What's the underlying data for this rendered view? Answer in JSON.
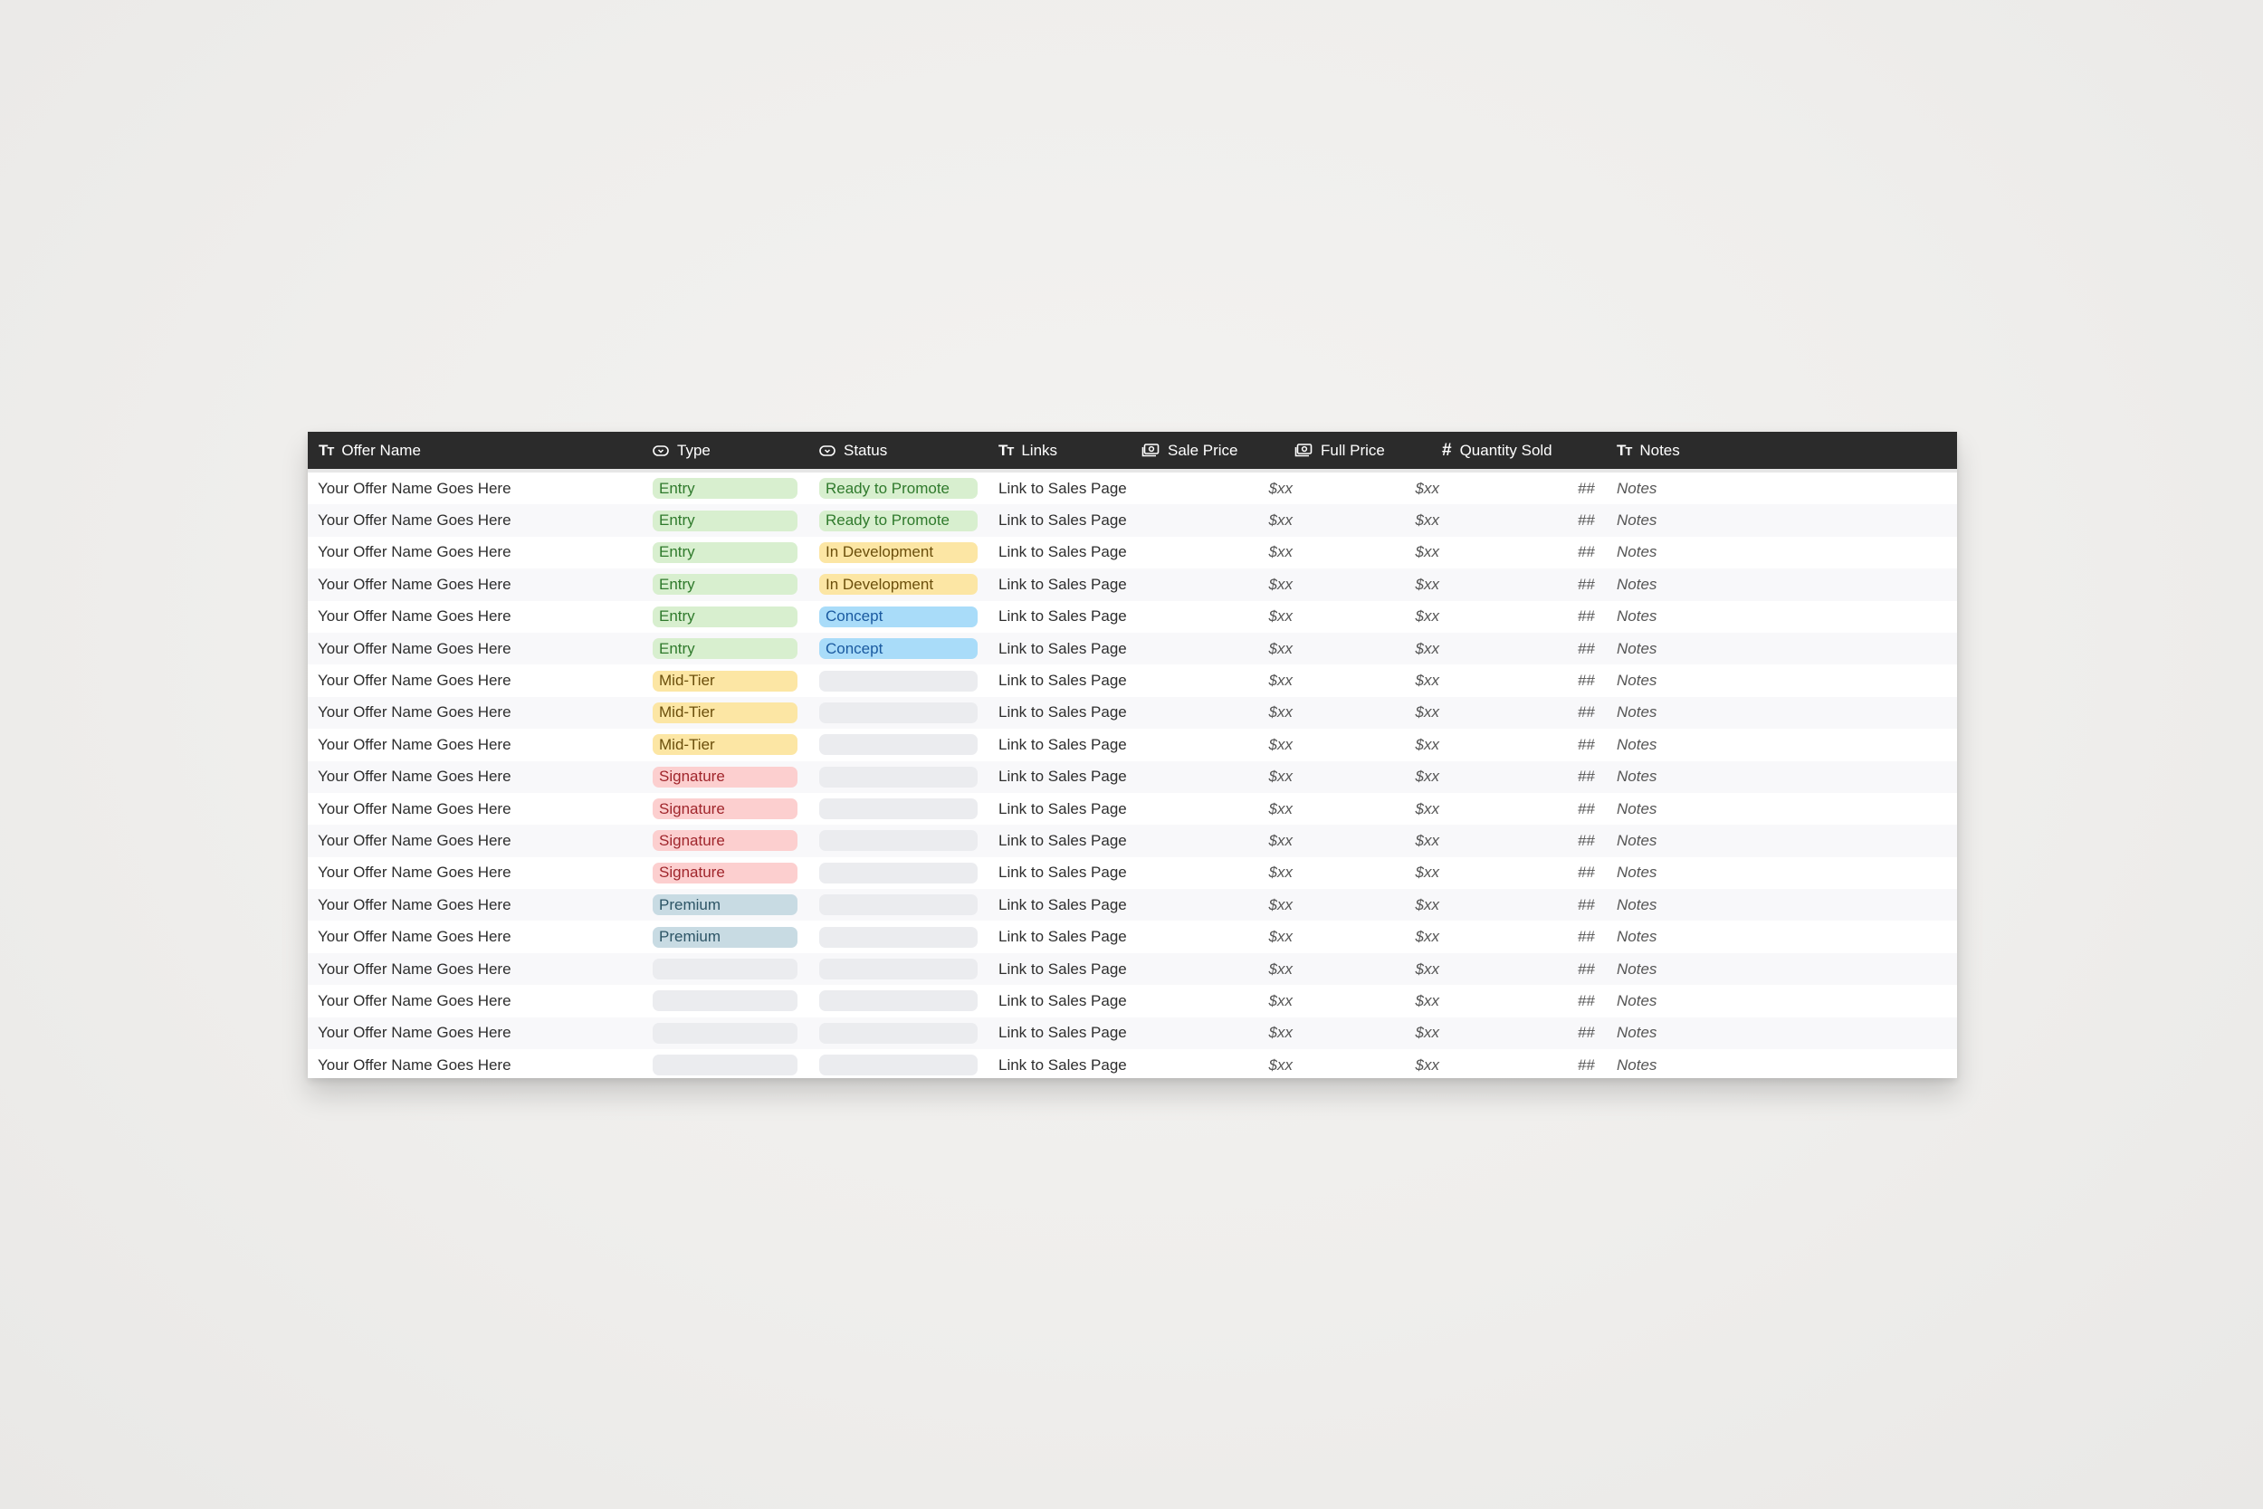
{
  "table": {
    "columns": [
      {
        "key": "name",
        "label": "Offer Name",
        "icon": "text-type-icon"
      },
      {
        "key": "type",
        "label": "Type",
        "icon": "select-icon"
      },
      {
        "key": "status",
        "label": "Status",
        "icon": "select-icon"
      },
      {
        "key": "links",
        "label": "Links",
        "icon": "text-type-icon"
      },
      {
        "key": "sale",
        "label": "Sale Price",
        "icon": "currency-icon"
      },
      {
        "key": "full",
        "label": "Full Price",
        "icon": "currency-icon"
      },
      {
        "key": "qty",
        "label": "Quantity Sold",
        "icon": "number-hash-icon"
      },
      {
        "key": "notes",
        "label": "Notes",
        "icon": "text-type-icon"
      }
    ],
    "colors": {
      "header_bg": "#2b2b2b",
      "row_alt_bg": "#f8f8fa",
      "empty_pill": "#ebecef"
    },
    "tags": {
      "Entry": {
        "bg": "#d8efcf",
        "fg": "#2f7a2c"
      },
      "Mid-Tier": {
        "bg": "#fce6a4",
        "fg": "#6b4f0c"
      },
      "Signature": {
        "bg": "#fccfcf",
        "fg": "#a0262c"
      },
      "Premium": {
        "bg": "#c8dbe3",
        "fg": "#2d5566"
      },
      "Ready to Promote": {
        "bg": "#d8efcf",
        "fg": "#2f7a2c"
      },
      "In Development": {
        "bg": "#fce6a4",
        "fg": "#6b4f0c"
      },
      "Concept": {
        "bg": "#a9dcf9",
        "fg": "#1a5aa0"
      }
    },
    "rows": [
      {
        "name": "Your Offer Name Goes Here",
        "type": "Entry",
        "status": "Ready to Promote",
        "links": "Link to Sales Page",
        "sale": "$xx",
        "full": "$xx",
        "qty": "##",
        "notes": "Notes"
      },
      {
        "name": "Your Offer Name Goes Here",
        "type": "Entry",
        "status": "Ready to Promote",
        "links": "Link to Sales Page",
        "sale": "$xx",
        "full": "$xx",
        "qty": "##",
        "notes": "Notes"
      },
      {
        "name": "Your Offer Name Goes Here",
        "type": "Entry",
        "status": "In Development",
        "links": "Link to Sales Page",
        "sale": "$xx",
        "full": "$xx",
        "qty": "##",
        "notes": "Notes"
      },
      {
        "name": "Your Offer Name Goes Here",
        "type": "Entry",
        "status": "In Development",
        "links": "Link to Sales Page",
        "sale": "$xx",
        "full": "$xx",
        "qty": "##",
        "notes": "Notes"
      },
      {
        "name": "Your Offer Name Goes Here",
        "type": "Entry",
        "status": "Concept",
        "links": "Link to Sales Page",
        "sale": "$xx",
        "full": "$xx",
        "qty": "##",
        "notes": "Notes"
      },
      {
        "name": "Your Offer Name Goes Here",
        "type": "Entry",
        "status": "Concept",
        "links": "Link to Sales Page",
        "sale": "$xx",
        "full": "$xx",
        "qty": "##",
        "notes": "Notes"
      },
      {
        "name": "Your Offer Name Goes Here",
        "type": "Mid-Tier",
        "status": "",
        "links": "Link to Sales Page",
        "sale": "$xx",
        "full": "$xx",
        "qty": "##",
        "notes": "Notes"
      },
      {
        "name": "Your Offer Name Goes Here",
        "type": "Mid-Tier",
        "status": "",
        "links": "Link to Sales Page",
        "sale": "$xx",
        "full": "$xx",
        "qty": "##",
        "notes": "Notes"
      },
      {
        "name": "Your Offer Name Goes Here",
        "type": "Mid-Tier",
        "status": "",
        "links": "Link to Sales Page",
        "sale": "$xx",
        "full": "$xx",
        "qty": "##",
        "notes": "Notes"
      },
      {
        "name": "Your Offer Name Goes Here",
        "type": "Signature",
        "status": "",
        "links": "Link to Sales Page",
        "sale": "$xx",
        "full": "$xx",
        "qty": "##",
        "notes": "Notes"
      },
      {
        "name": "Your Offer Name Goes Here",
        "type": "Signature",
        "status": "",
        "links": "Link to Sales Page",
        "sale": "$xx",
        "full": "$xx",
        "qty": "##",
        "notes": "Notes"
      },
      {
        "name": "Your Offer Name Goes Here",
        "type": "Signature",
        "status": "",
        "links": "Link to Sales Page",
        "sale": "$xx",
        "full": "$xx",
        "qty": "##",
        "notes": "Notes"
      },
      {
        "name": "Your Offer Name Goes Here",
        "type": "Signature",
        "status": "",
        "links": "Link to Sales Page",
        "sale": "$xx",
        "full": "$xx",
        "qty": "##",
        "notes": "Notes"
      },
      {
        "name": "Your Offer Name Goes Here",
        "type": "Premium",
        "status": "",
        "links": "Link to Sales Page",
        "sale": "$xx",
        "full": "$xx",
        "qty": "##",
        "notes": "Notes"
      },
      {
        "name": "Your Offer Name Goes Here",
        "type": "Premium",
        "status": "",
        "links": "Link to Sales Page",
        "sale": "$xx",
        "full": "$xx",
        "qty": "##",
        "notes": "Notes"
      },
      {
        "name": "Your Offer Name Goes Here",
        "type": "",
        "status": "",
        "links": "Link to Sales Page",
        "sale": "$xx",
        "full": "$xx",
        "qty": "##",
        "notes": "Notes"
      },
      {
        "name": "Your Offer Name Goes Here",
        "type": "",
        "status": "",
        "links": "Link to Sales Page",
        "sale": "$xx",
        "full": "$xx",
        "qty": "##",
        "notes": "Notes"
      },
      {
        "name": "Your Offer Name Goes Here",
        "type": "",
        "status": "",
        "links": "Link to Sales Page",
        "sale": "$xx",
        "full": "$xx",
        "qty": "##",
        "notes": "Notes"
      },
      {
        "name": "Your Offer Name Goes Here",
        "type": "",
        "status": "",
        "links": "Link to Sales Page",
        "sale": "$xx",
        "full": "$xx",
        "qty": "##",
        "notes": "Notes"
      }
    ]
  }
}
